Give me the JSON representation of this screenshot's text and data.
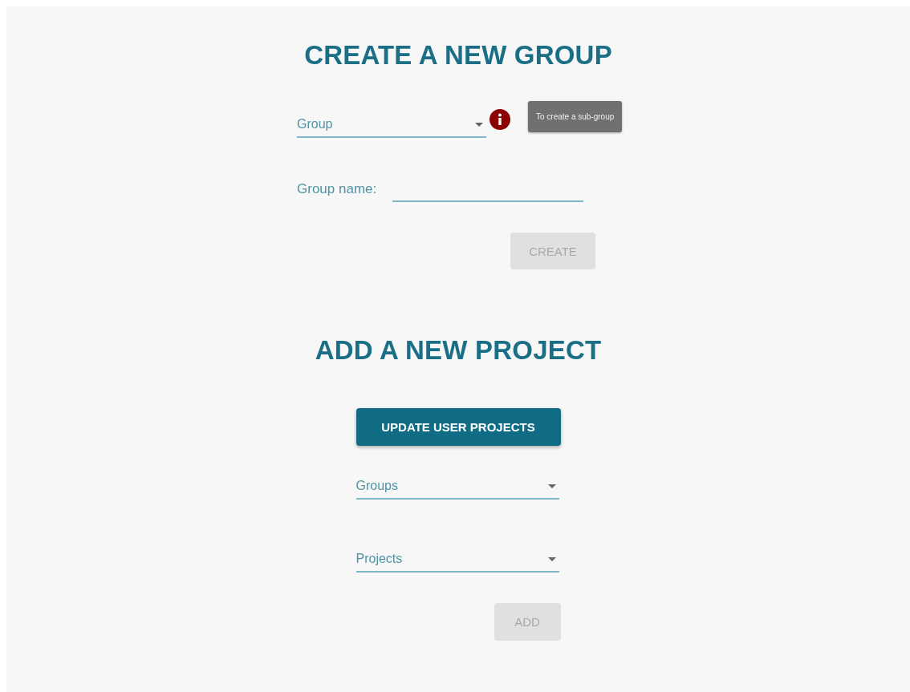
{
  "create_group": {
    "title": "CREATE A NEW GROUP",
    "group_select": {
      "placeholder": "Group"
    },
    "info_tooltip": "To create a sub-group",
    "group_name": {
      "label": "Group name:"
    },
    "create_button": {
      "label": "CREATE",
      "disabled": true
    }
  },
  "add_project": {
    "title": "ADD A NEW PROJECT",
    "update_button": {
      "label": "UPDATE USER PROJECTS",
      "disabled": false
    },
    "selects": [
      {
        "placeholder": "Groups"
      },
      {
        "placeholder": "Projects"
      }
    ],
    "add_button": {
      "label": "ADD",
      "disabled": true
    }
  }
}
